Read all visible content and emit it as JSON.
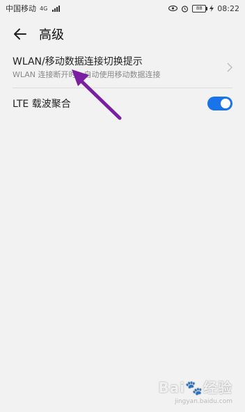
{
  "status_bar": {
    "carrier": "中国移动",
    "network": "4G",
    "battery": "88",
    "time": "08:22"
  },
  "header": {
    "back_icon": "arrow-left-icon",
    "title": "高级"
  },
  "settings": [
    {
      "title": "WLAN/移动数据连接切换提示",
      "subtitle": "WLAN 连接断开时，自动使用移动数据连接",
      "control": "chevron-right-icon"
    },
    {
      "title": "LTE 载波聚合",
      "control": "toggle",
      "enabled": true
    }
  ],
  "colors": {
    "accent": "#1a73e8",
    "annotation_arrow": "#7b1fa2",
    "background": "#f2f2f2"
  },
  "watermark": {
    "main": "Bai🐾经验",
    "sub": "jingyan.baidu.com"
  }
}
